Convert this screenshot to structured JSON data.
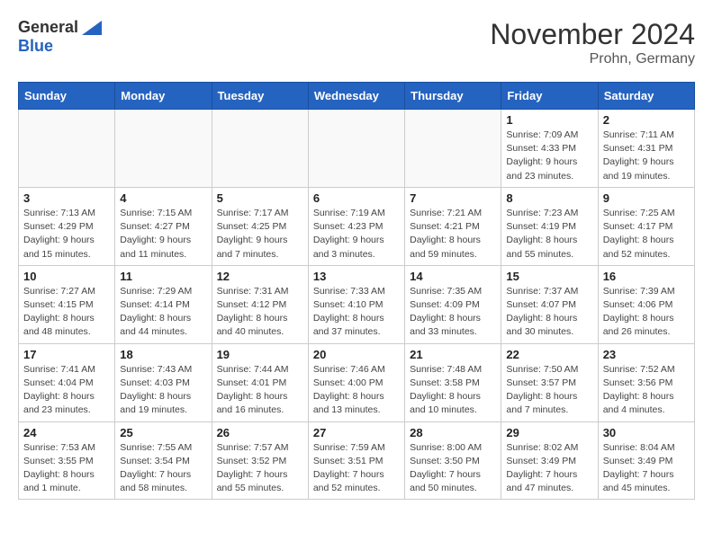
{
  "logo": {
    "general": "General",
    "blue": "Blue"
  },
  "title": "November 2024",
  "location": "Prohn, Germany",
  "days_of_week": [
    "Sunday",
    "Monday",
    "Tuesday",
    "Wednesday",
    "Thursday",
    "Friday",
    "Saturday"
  ],
  "weeks": [
    [
      {
        "day": "",
        "info": ""
      },
      {
        "day": "",
        "info": ""
      },
      {
        "day": "",
        "info": ""
      },
      {
        "day": "",
        "info": ""
      },
      {
        "day": "",
        "info": ""
      },
      {
        "day": "1",
        "info": "Sunrise: 7:09 AM\nSunset: 4:33 PM\nDaylight: 9 hours\nand 23 minutes."
      },
      {
        "day": "2",
        "info": "Sunrise: 7:11 AM\nSunset: 4:31 PM\nDaylight: 9 hours\nand 19 minutes."
      }
    ],
    [
      {
        "day": "3",
        "info": "Sunrise: 7:13 AM\nSunset: 4:29 PM\nDaylight: 9 hours\nand 15 minutes."
      },
      {
        "day": "4",
        "info": "Sunrise: 7:15 AM\nSunset: 4:27 PM\nDaylight: 9 hours\nand 11 minutes."
      },
      {
        "day": "5",
        "info": "Sunrise: 7:17 AM\nSunset: 4:25 PM\nDaylight: 9 hours\nand 7 minutes."
      },
      {
        "day": "6",
        "info": "Sunrise: 7:19 AM\nSunset: 4:23 PM\nDaylight: 9 hours\nand 3 minutes."
      },
      {
        "day": "7",
        "info": "Sunrise: 7:21 AM\nSunset: 4:21 PM\nDaylight: 8 hours\nand 59 minutes."
      },
      {
        "day": "8",
        "info": "Sunrise: 7:23 AM\nSunset: 4:19 PM\nDaylight: 8 hours\nand 55 minutes."
      },
      {
        "day": "9",
        "info": "Sunrise: 7:25 AM\nSunset: 4:17 PM\nDaylight: 8 hours\nand 52 minutes."
      }
    ],
    [
      {
        "day": "10",
        "info": "Sunrise: 7:27 AM\nSunset: 4:15 PM\nDaylight: 8 hours\nand 48 minutes."
      },
      {
        "day": "11",
        "info": "Sunrise: 7:29 AM\nSunset: 4:14 PM\nDaylight: 8 hours\nand 44 minutes."
      },
      {
        "day": "12",
        "info": "Sunrise: 7:31 AM\nSunset: 4:12 PM\nDaylight: 8 hours\nand 40 minutes."
      },
      {
        "day": "13",
        "info": "Sunrise: 7:33 AM\nSunset: 4:10 PM\nDaylight: 8 hours\nand 37 minutes."
      },
      {
        "day": "14",
        "info": "Sunrise: 7:35 AM\nSunset: 4:09 PM\nDaylight: 8 hours\nand 33 minutes."
      },
      {
        "day": "15",
        "info": "Sunrise: 7:37 AM\nSunset: 4:07 PM\nDaylight: 8 hours\nand 30 minutes."
      },
      {
        "day": "16",
        "info": "Sunrise: 7:39 AM\nSunset: 4:06 PM\nDaylight: 8 hours\nand 26 minutes."
      }
    ],
    [
      {
        "day": "17",
        "info": "Sunrise: 7:41 AM\nSunset: 4:04 PM\nDaylight: 8 hours\nand 23 minutes."
      },
      {
        "day": "18",
        "info": "Sunrise: 7:43 AM\nSunset: 4:03 PM\nDaylight: 8 hours\nand 19 minutes."
      },
      {
        "day": "19",
        "info": "Sunrise: 7:44 AM\nSunset: 4:01 PM\nDaylight: 8 hours\nand 16 minutes."
      },
      {
        "day": "20",
        "info": "Sunrise: 7:46 AM\nSunset: 4:00 PM\nDaylight: 8 hours\nand 13 minutes."
      },
      {
        "day": "21",
        "info": "Sunrise: 7:48 AM\nSunset: 3:58 PM\nDaylight: 8 hours\nand 10 minutes."
      },
      {
        "day": "22",
        "info": "Sunrise: 7:50 AM\nSunset: 3:57 PM\nDaylight: 8 hours\nand 7 minutes."
      },
      {
        "day": "23",
        "info": "Sunrise: 7:52 AM\nSunset: 3:56 PM\nDaylight: 8 hours\nand 4 minutes."
      }
    ],
    [
      {
        "day": "24",
        "info": "Sunrise: 7:53 AM\nSunset: 3:55 PM\nDaylight: 8 hours\nand 1 minute."
      },
      {
        "day": "25",
        "info": "Sunrise: 7:55 AM\nSunset: 3:54 PM\nDaylight: 7 hours\nand 58 minutes."
      },
      {
        "day": "26",
        "info": "Sunrise: 7:57 AM\nSunset: 3:52 PM\nDaylight: 7 hours\nand 55 minutes."
      },
      {
        "day": "27",
        "info": "Sunrise: 7:59 AM\nSunset: 3:51 PM\nDaylight: 7 hours\nand 52 minutes."
      },
      {
        "day": "28",
        "info": "Sunrise: 8:00 AM\nSunset: 3:50 PM\nDaylight: 7 hours\nand 50 minutes."
      },
      {
        "day": "29",
        "info": "Sunrise: 8:02 AM\nSunset: 3:49 PM\nDaylight: 7 hours\nand 47 minutes."
      },
      {
        "day": "30",
        "info": "Sunrise: 8:04 AM\nSunset: 3:49 PM\nDaylight: 7 hours\nand 45 minutes."
      }
    ]
  ]
}
